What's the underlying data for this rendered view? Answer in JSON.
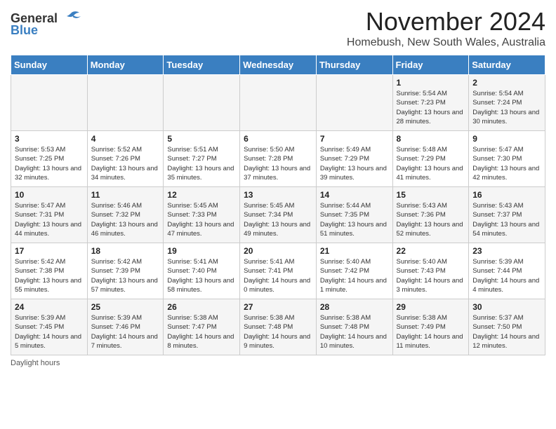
{
  "header": {
    "logo_general": "General",
    "logo_blue": "Blue",
    "month_title": "November 2024",
    "subtitle": "Homebush, New South Wales, Australia"
  },
  "calendar": {
    "days_of_week": [
      "Sunday",
      "Monday",
      "Tuesday",
      "Wednesday",
      "Thursday",
      "Friday",
      "Saturday"
    ],
    "weeks": [
      [
        {
          "day": "",
          "info": ""
        },
        {
          "day": "",
          "info": ""
        },
        {
          "day": "",
          "info": ""
        },
        {
          "day": "",
          "info": ""
        },
        {
          "day": "",
          "info": ""
        },
        {
          "day": "1",
          "info": "Sunrise: 5:54 AM\nSunset: 7:23 PM\nDaylight: 13 hours and 28 minutes."
        },
        {
          "day": "2",
          "info": "Sunrise: 5:54 AM\nSunset: 7:24 PM\nDaylight: 13 hours and 30 minutes."
        }
      ],
      [
        {
          "day": "3",
          "info": "Sunrise: 5:53 AM\nSunset: 7:25 PM\nDaylight: 13 hours and 32 minutes."
        },
        {
          "day": "4",
          "info": "Sunrise: 5:52 AM\nSunset: 7:26 PM\nDaylight: 13 hours and 34 minutes."
        },
        {
          "day": "5",
          "info": "Sunrise: 5:51 AM\nSunset: 7:27 PM\nDaylight: 13 hours and 35 minutes."
        },
        {
          "day": "6",
          "info": "Sunrise: 5:50 AM\nSunset: 7:28 PM\nDaylight: 13 hours and 37 minutes."
        },
        {
          "day": "7",
          "info": "Sunrise: 5:49 AM\nSunset: 7:29 PM\nDaylight: 13 hours and 39 minutes."
        },
        {
          "day": "8",
          "info": "Sunrise: 5:48 AM\nSunset: 7:29 PM\nDaylight: 13 hours and 41 minutes."
        },
        {
          "day": "9",
          "info": "Sunrise: 5:47 AM\nSunset: 7:30 PM\nDaylight: 13 hours and 42 minutes."
        }
      ],
      [
        {
          "day": "10",
          "info": "Sunrise: 5:47 AM\nSunset: 7:31 PM\nDaylight: 13 hours and 44 minutes."
        },
        {
          "day": "11",
          "info": "Sunrise: 5:46 AM\nSunset: 7:32 PM\nDaylight: 13 hours and 46 minutes."
        },
        {
          "day": "12",
          "info": "Sunrise: 5:45 AM\nSunset: 7:33 PM\nDaylight: 13 hours and 47 minutes."
        },
        {
          "day": "13",
          "info": "Sunrise: 5:45 AM\nSunset: 7:34 PM\nDaylight: 13 hours and 49 minutes."
        },
        {
          "day": "14",
          "info": "Sunrise: 5:44 AM\nSunset: 7:35 PM\nDaylight: 13 hours and 51 minutes."
        },
        {
          "day": "15",
          "info": "Sunrise: 5:43 AM\nSunset: 7:36 PM\nDaylight: 13 hours and 52 minutes."
        },
        {
          "day": "16",
          "info": "Sunrise: 5:43 AM\nSunset: 7:37 PM\nDaylight: 13 hours and 54 minutes."
        }
      ],
      [
        {
          "day": "17",
          "info": "Sunrise: 5:42 AM\nSunset: 7:38 PM\nDaylight: 13 hours and 55 minutes."
        },
        {
          "day": "18",
          "info": "Sunrise: 5:42 AM\nSunset: 7:39 PM\nDaylight: 13 hours and 57 minutes."
        },
        {
          "day": "19",
          "info": "Sunrise: 5:41 AM\nSunset: 7:40 PM\nDaylight: 13 hours and 58 minutes."
        },
        {
          "day": "20",
          "info": "Sunrise: 5:41 AM\nSunset: 7:41 PM\nDaylight: 14 hours and 0 minutes."
        },
        {
          "day": "21",
          "info": "Sunrise: 5:40 AM\nSunset: 7:42 PM\nDaylight: 14 hours and 1 minute."
        },
        {
          "day": "22",
          "info": "Sunrise: 5:40 AM\nSunset: 7:43 PM\nDaylight: 14 hours and 3 minutes."
        },
        {
          "day": "23",
          "info": "Sunrise: 5:39 AM\nSunset: 7:44 PM\nDaylight: 14 hours and 4 minutes."
        }
      ],
      [
        {
          "day": "24",
          "info": "Sunrise: 5:39 AM\nSunset: 7:45 PM\nDaylight: 14 hours and 5 minutes."
        },
        {
          "day": "25",
          "info": "Sunrise: 5:39 AM\nSunset: 7:46 PM\nDaylight: 14 hours and 7 minutes."
        },
        {
          "day": "26",
          "info": "Sunrise: 5:38 AM\nSunset: 7:47 PM\nDaylight: 14 hours and 8 minutes."
        },
        {
          "day": "27",
          "info": "Sunrise: 5:38 AM\nSunset: 7:48 PM\nDaylight: 14 hours and 9 minutes."
        },
        {
          "day": "28",
          "info": "Sunrise: 5:38 AM\nSunset: 7:48 PM\nDaylight: 14 hours and 10 minutes."
        },
        {
          "day": "29",
          "info": "Sunrise: 5:38 AM\nSunset: 7:49 PM\nDaylight: 14 hours and 11 minutes."
        },
        {
          "day": "30",
          "info": "Sunrise: 5:37 AM\nSunset: 7:50 PM\nDaylight: 14 hours and 12 minutes."
        }
      ]
    ]
  },
  "footer": {
    "daylight_hours": "Daylight hours"
  }
}
